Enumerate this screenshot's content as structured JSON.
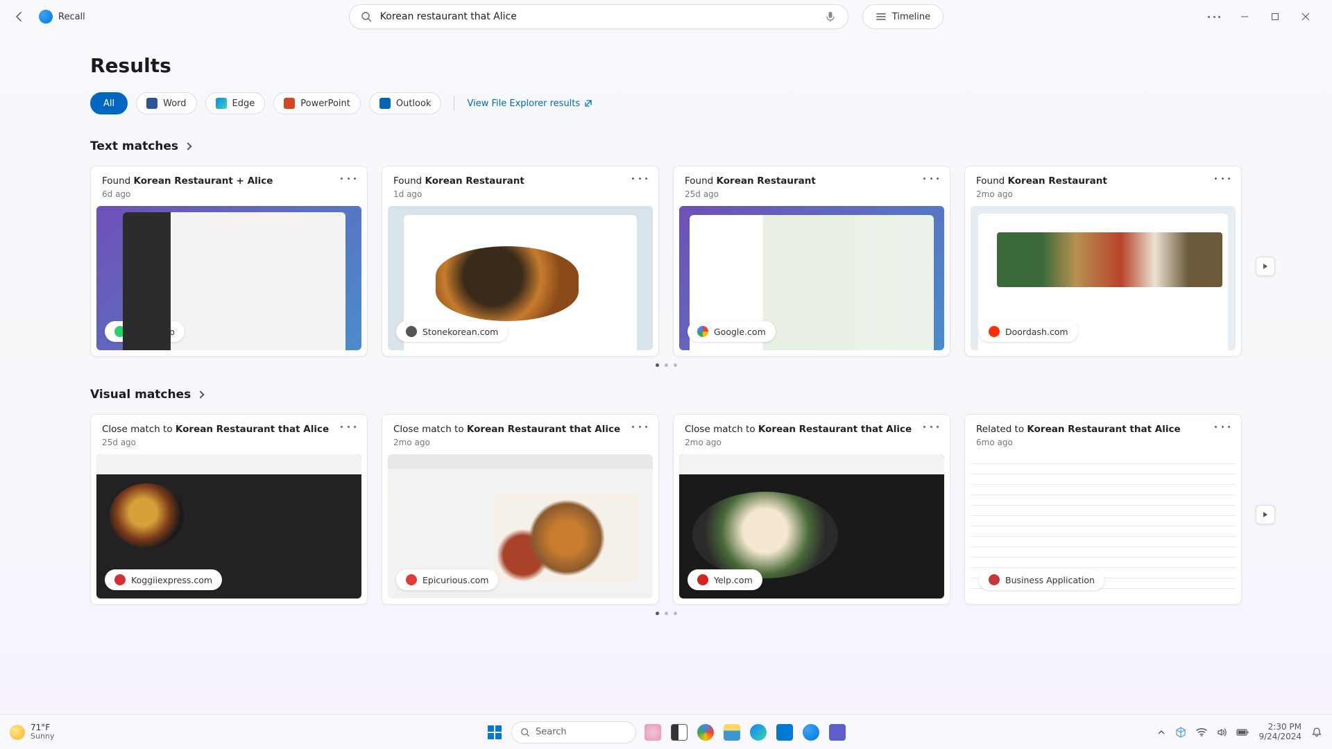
{
  "app": {
    "title": "Recall"
  },
  "search": {
    "value": "Korean restaurant that Alice"
  },
  "timeline_label": "Timeline",
  "results_heading": "Results",
  "filters": {
    "all": "All",
    "word": "Word",
    "edge": "Edge",
    "powerpoint": "PowerPoint",
    "outlook": "Outlook"
  },
  "file_explorer_link": "View File Explorer results",
  "sections": {
    "text_matches": "Text matches",
    "visual_matches": "Visual matches"
  },
  "text_cards": [
    {
      "prefix": "Found ",
      "bold": "Korean Restaurant + Alice",
      "time": "6d ago",
      "source": "Whatsapp",
      "source_color": "#25d366"
    },
    {
      "prefix": "Found ",
      "bold": "Korean Restaurant",
      "time": "1d ago",
      "source": "Stonekorean.com",
      "source_color": "#555"
    },
    {
      "prefix": "Found ",
      "bold": "Korean Restaurant",
      "time": "25d ago",
      "source": "Google.com",
      "source_color": "#4285f4"
    },
    {
      "prefix": "Found ",
      "bold": "Korean Restaurant",
      "time": "2mo ago",
      "source": "Doordash.com",
      "source_color": "#ff3008"
    }
  ],
  "visual_cards": [
    {
      "prefix": "Close match to ",
      "bold": "Korean Restaurant that Alice",
      "time": "25d ago",
      "source": "Koggiiexpress.com",
      "source_color": "#d62f2f"
    },
    {
      "prefix": "Close match to ",
      "bold": "Korean Restaurant that Alice",
      "time": "2mo ago",
      "source": "Epicurious.com",
      "source_color": "#e03a3a"
    },
    {
      "prefix": "Close match to ",
      "bold": "Korean Restaurant that Alice",
      "time": "2mo ago",
      "source": "Yelp.com",
      "source_color": "#d32323"
    },
    {
      "prefix": "Related to ",
      "bold": "Korean Restaurant that Alice",
      "time": "6mo ago",
      "source": "Business Application",
      "source_color": "#c23a3a"
    }
  ],
  "taskbar": {
    "temp": "71°F",
    "condition": "Sunny",
    "search_placeholder": "Search",
    "time": "2:30 PM",
    "date": "9/24/2024"
  }
}
